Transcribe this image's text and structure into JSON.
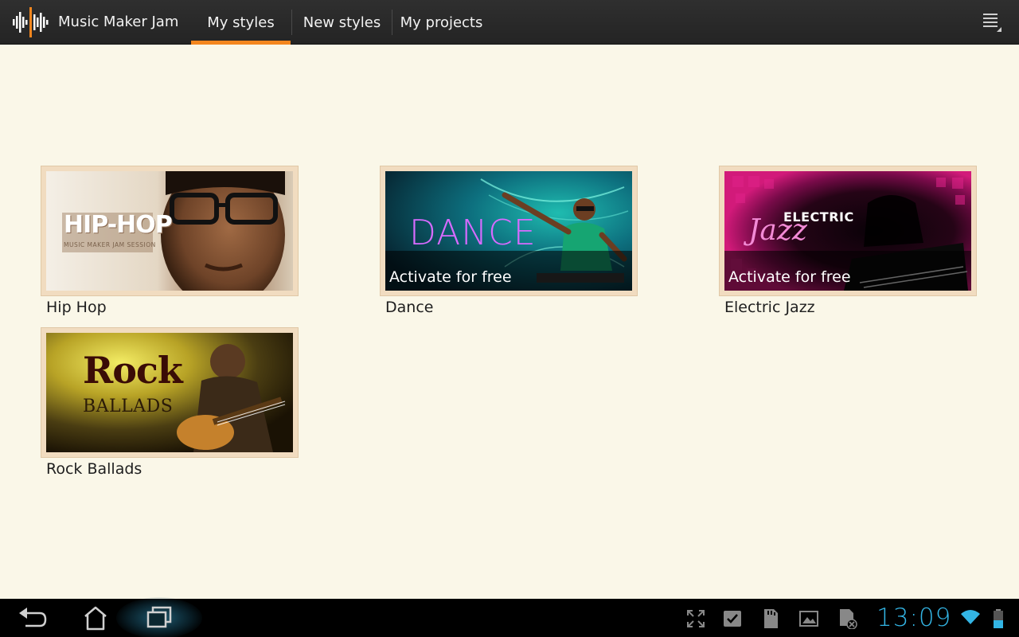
{
  "app": {
    "title": "Music Maker Jam",
    "logo_icon": "waveform-icon",
    "accent": "#f3861e"
  },
  "tabs": [
    {
      "label": "My styles",
      "active": true
    },
    {
      "label": "New styles",
      "active": false
    },
    {
      "label": "My projects",
      "active": false
    }
  ],
  "styles": [
    {
      "name": "Hip Hop",
      "thumb_text": "HIP-HOP",
      "thumb_subtext": "MUSIC MAKER JAM SESSION",
      "activate": null
    },
    {
      "name": "Dance",
      "thumb_text": "DANCE",
      "activate": "Activate for free"
    },
    {
      "name": "Electric Jazz",
      "thumb_text_1": "ELECTRIC",
      "thumb_text_2": "Jazz",
      "activate": "Activate for free"
    },
    {
      "name": "Rock Ballads",
      "thumb_text_1": "Rock",
      "thumb_text_2": "BALLADS",
      "activate": null
    }
  ],
  "system_bar": {
    "clock": "13:09",
    "clock_color": "#33b5e5",
    "nav": [
      "back-icon",
      "home-icon",
      "recent-apps-icon"
    ],
    "status_icons": [
      "screen-expand-icon",
      "checkbox-icon",
      "sd-card-icon",
      "gallery-icon",
      "sd-card-removed-icon",
      "wifi-icon",
      "battery-icon"
    ]
  }
}
